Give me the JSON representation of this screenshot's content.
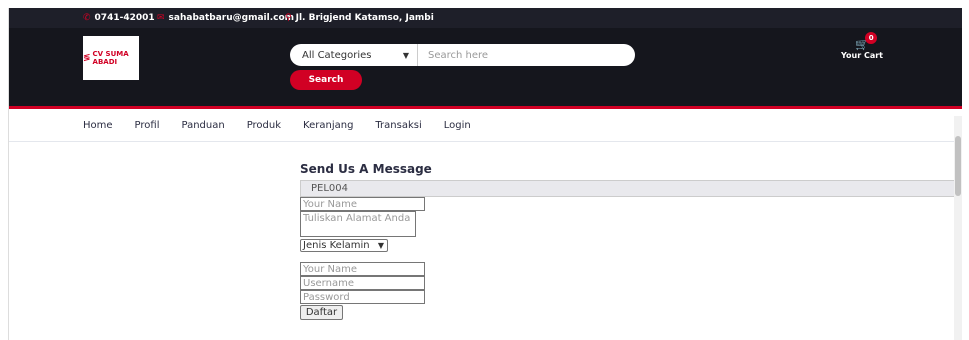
{
  "topbar": {
    "phone": "0741-42001",
    "email": "sahabatbaru@gmail.com",
    "address": "Jl. Brigjend Katamso, Jambi"
  },
  "logo": {
    "text": "CV SUMA ABADI"
  },
  "search": {
    "category_label": "All Categories",
    "placeholder": "Search here",
    "button_label": "Search"
  },
  "cart": {
    "label": "Your Cart",
    "count": "0"
  },
  "nav": {
    "items": [
      "Home",
      "Profil",
      "Panduan",
      "Produk",
      "Keranjang",
      "Transaksi",
      "Login"
    ]
  },
  "form": {
    "title": "Send Us A Message",
    "id_value": "PEL004",
    "name_placeholder": "Your Name",
    "address_placeholder": "Tuliskan Alamat Anda",
    "gender_label": "Jenis Kelamin",
    "name2_placeholder": "Your Name",
    "username_placeholder": "Username",
    "password_placeholder": "Password",
    "submit_label": "Daftar"
  },
  "colors": {
    "accent": "#d10024",
    "dark": "#15161d",
    "topbar": "#1e1f29"
  }
}
